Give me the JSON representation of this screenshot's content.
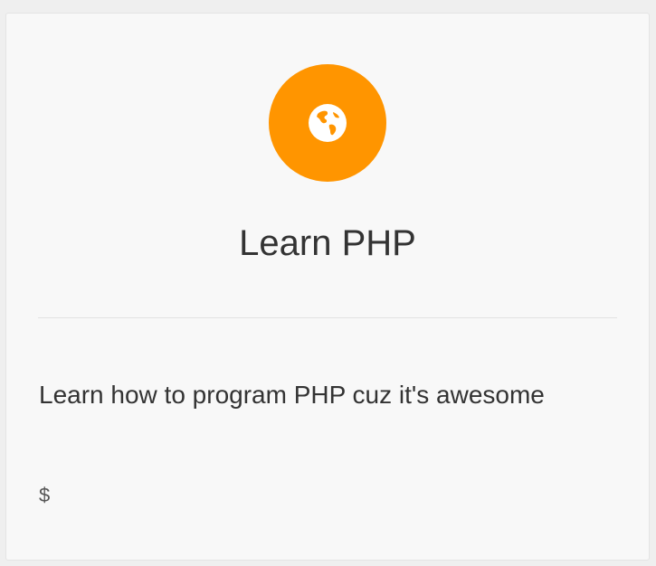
{
  "card": {
    "icon": "globe-icon",
    "icon_color": "#FF9500",
    "title": "Learn PHP",
    "description": "Learn how to program PHP cuz it's awesome",
    "price": "$"
  }
}
